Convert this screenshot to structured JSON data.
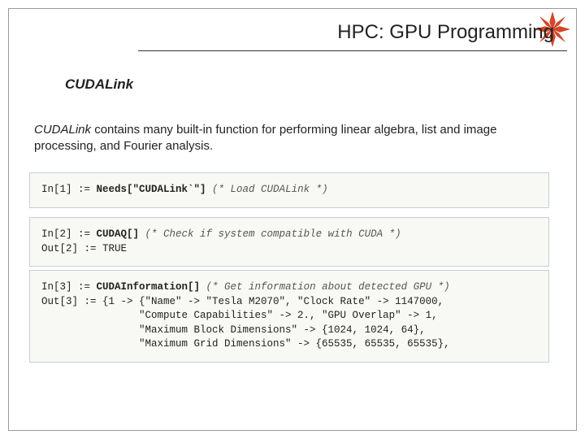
{
  "header": {
    "title": "HPC: GPU Programming"
  },
  "subtitle": "CUDALink",
  "body": {
    "prefix_em": "CUDALink",
    "rest": " contains many built-in function for performing linear algebra, list and image processing, and Fourier analysis."
  },
  "code1": {
    "line1_pre": "In[1] := ",
    "line1_bold": "Needs[\"CUDALink`\"]",
    "line1_comment": " (* Load CUDALink *)"
  },
  "code2": {
    "line1_pre": "In[2] := ",
    "line1_bold": "CUDAQ[]",
    "line1_comment": " (* Check if system compatible with CUDA *)",
    "line2": "Out[2] := TRUE"
  },
  "code3": {
    "line1_pre": "In[3] := ",
    "line1_bold": "CUDAInformation[]",
    "line1_comment": " (* Get information about detected GPU *)",
    "line2": "Out[3] := {1 -> {\"Name\" -> \"Tesla M2070\", \"Clock Rate\" -> 1147000,",
    "line3": "                \"Compute Capabilities\" -> 2., \"GPU Overlap\" -> 1,",
    "line4": "                \"Maximum Block Dimensions\" -> {1024, 1024, 64},",
    "line5": "                \"Maximum Grid Dimensions\" -> {65535, 65535, 65535},"
  }
}
